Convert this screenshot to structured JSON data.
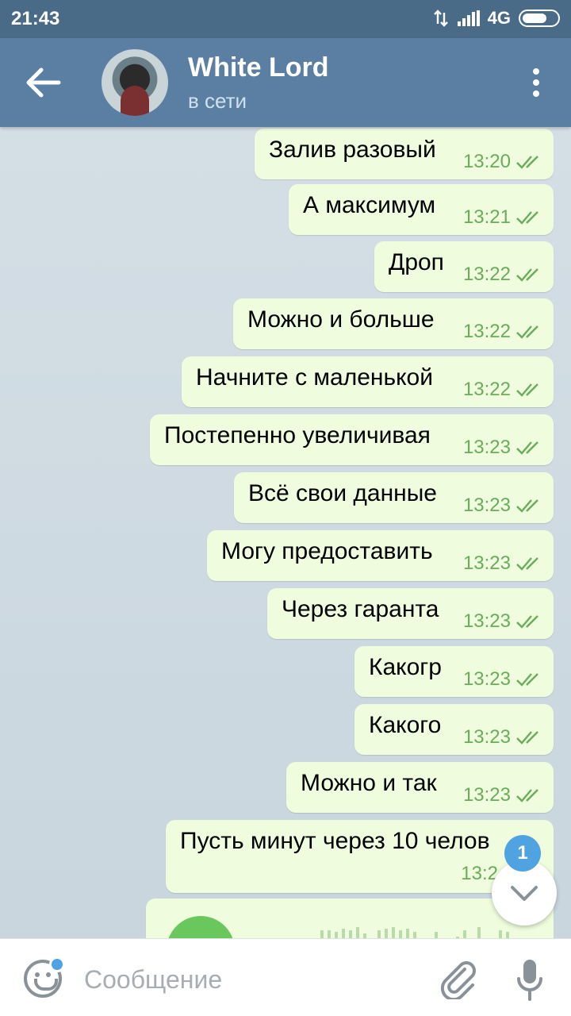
{
  "statusbar": {
    "time": "21:43",
    "network": "4G"
  },
  "header": {
    "title": "White Lord",
    "subtitle": "в сети"
  },
  "messages": [
    {
      "text": "Залив разовый",
      "time": "13:20"
    },
    {
      "text": "А максимум",
      "time": "13:21"
    },
    {
      "text": "Дроп",
      "time": "13:22"
    },
    {
      "text": "Можно и больше",
      "time": "13:22"
    },
    {
      "text": "Начните с маленькой",
      "time": "13:22"
    },
    {
      "text": "Постепенно увеличивая",
      "time": "13:23"
    },
    {
      "text": "Всё свои данные",
      "time": "13:23"
    },
    {
      "text": "Могу предоставить",
      "time": "13:23"
    },
    {
      "text": "Через гаранта",
      "time": "13:23"
    },
    {
      "text": "Какогр",
      "time": "13:23"
    },
    {
      "text": "Какого",
      "time": "13:23"
    },
    {
      "text": "Можно и так",
      "time": "13:23"
    },
    {
      "text": "Пусть минут через 10 челов",
      "time": "13:2"
    }
  ],
  "unread_count": "1",
  "input": {
    "placeholder": "Сообщение"
  },
  "colors": {
    "header": "#5a7fa2",
    "bubble_out": "#effdde",
    "check": "#6aac5a",
    "accent": "#4fa3e0"
  }
}
